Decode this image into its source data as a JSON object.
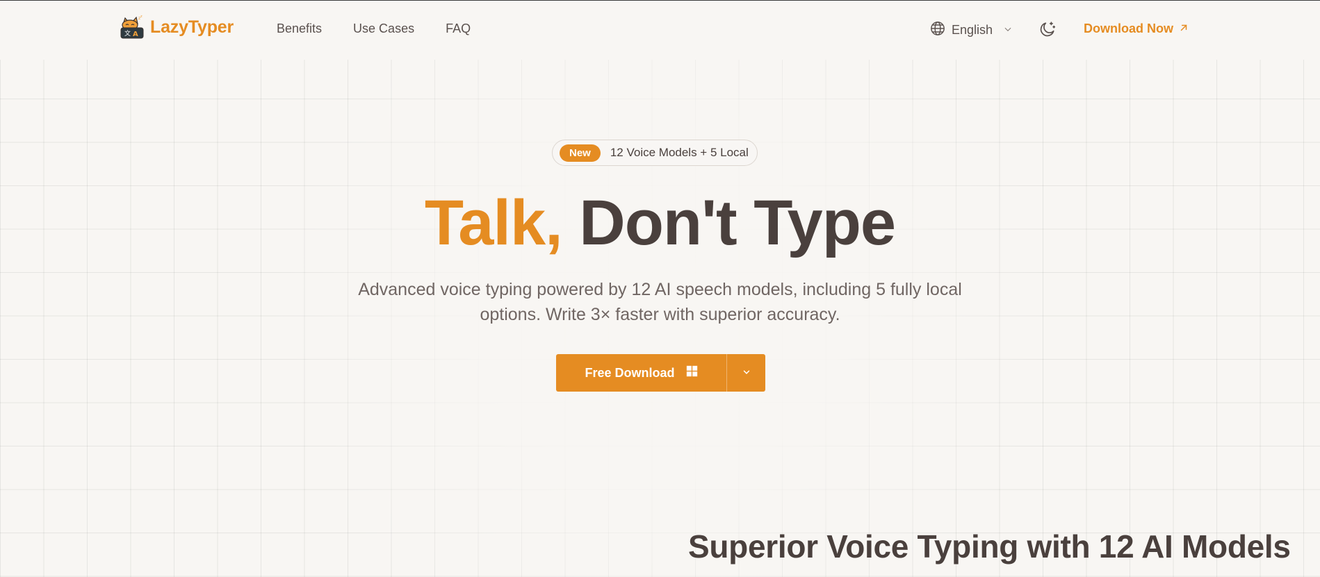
{
  "header": {
    "brand": "LazyTyper",
    "nav": [
      {
        "label": "Benefits"
      },
      {
        "label": "Use Cases"
      },
      {
        "label": "FAQ"
      }
    ],
    "language": "English",
    "download_label": "Download Now"
  },
  "hero": {
    "badge_tag": "New",
    "badge_text": "12 Voice Models + 5 Local",
    "title_accent": "Talk,",
    "title_rest": "Don't Type",
    "subtitle": "Advanced voice typing powered by 12 AI speech models, including 5 fully local options. Write 3× faster with superior accuracy.",
    "cta_label": "Free Download"
  },
  "section": {
    "title": "Superior Voice Typing with 12 AI Models"
  },
  "colors": {
    "accent": "#e58c22",
    "text_dark": "#4a403d",
    "background": "#f8f6f3"
  },
  "icons": {
    "logo": "cat-keyboard-logo",
    "language": "globe-icon",
    "language_caret": "chevron-down-icon",
    "theme": "moon-stars-icon",
    "external": "arrow-up-right-icon",
    "platform": "windows-icon",
    "dropdown": "chevron-down-icon"
  }
}
